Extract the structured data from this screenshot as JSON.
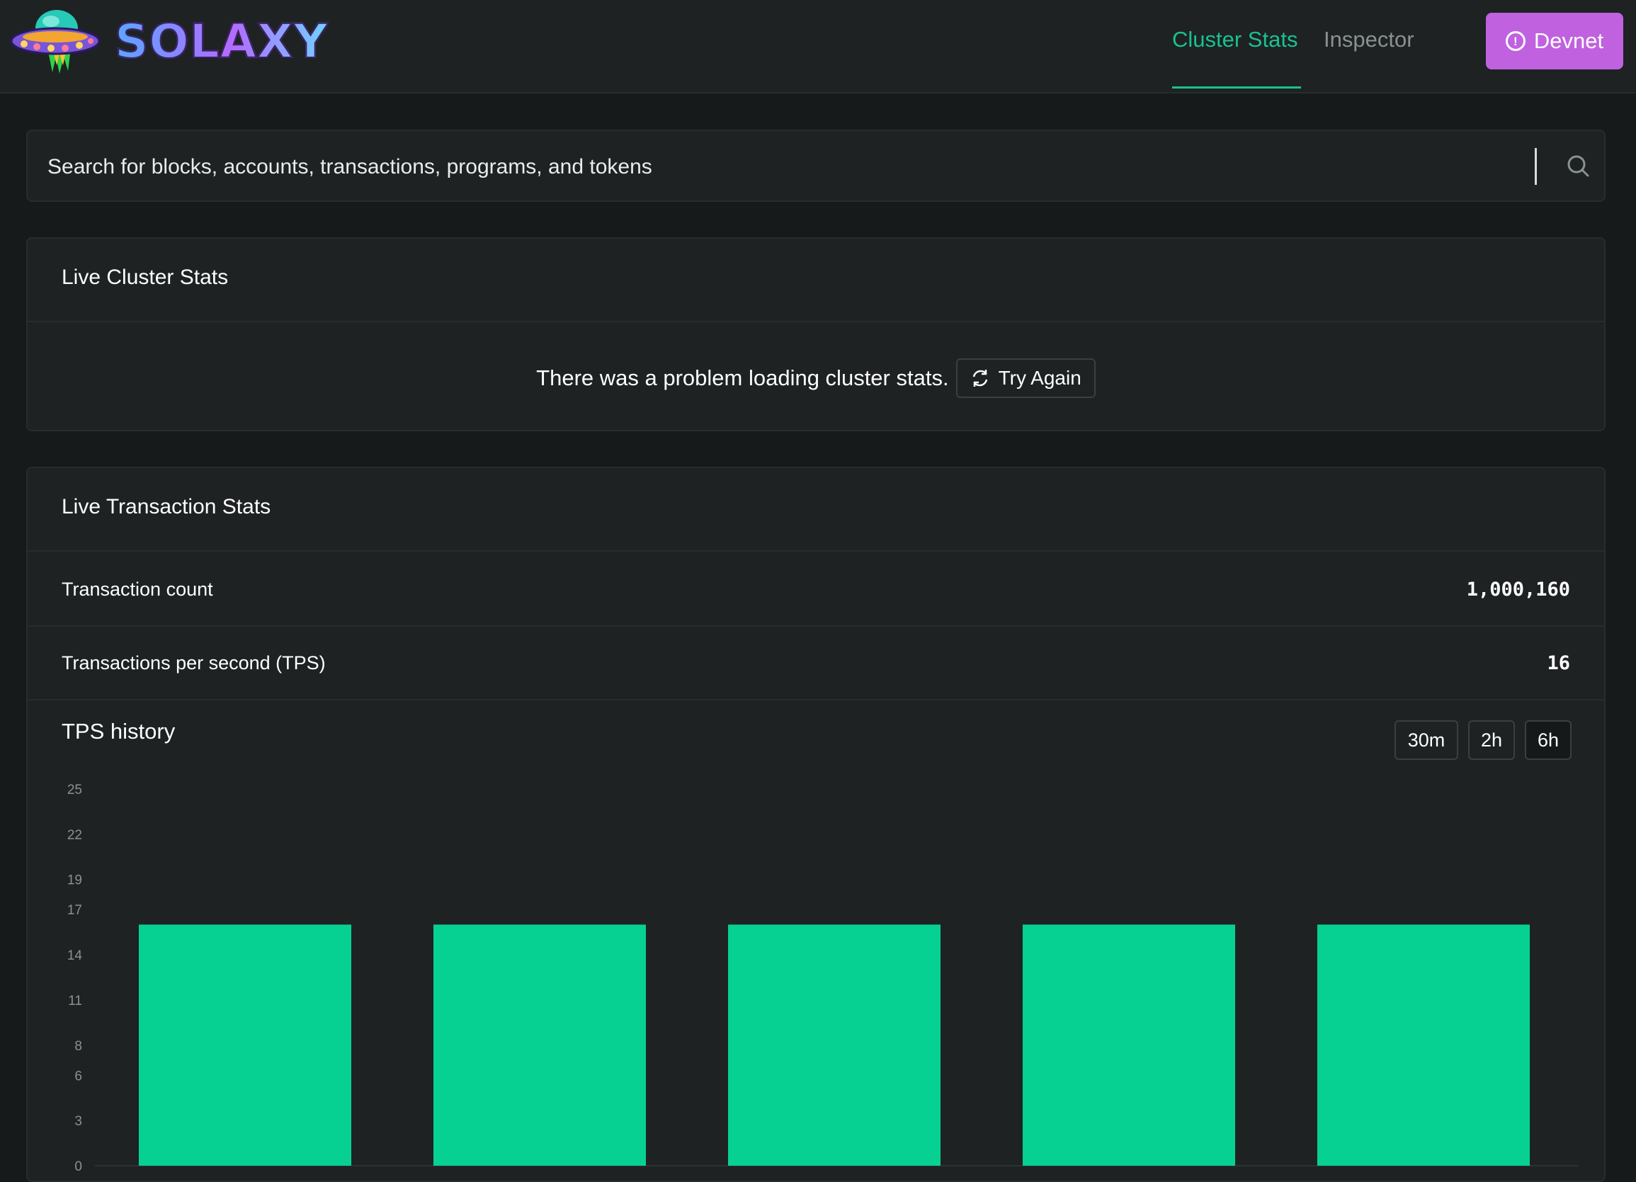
{
  "brand": {
    "name": "SOLAXY"
  },
  "nav": {
    "items": [
      {
        "label": "Cluster Stats",
        "active": true
      },
      {
        "label": "Inspector",
        "active": false
      }
    ],
    "cluster_button": "Devnet",
    "accent_color": "#19c28f",
    "cluster_color": "#c061e0"
  },
  "search": {
    "placeholder": "Search for blocks, accounts, transactions, programs, and tokens",
    "value": ""
  },
  "cluster_stats": {
    "title": "Live Cluster Stats",
    "error_message": "There was a problem loading cluster stats.",
    "retry_label": "Try Again"
  },
  "transaction_stats": {
    "title": "Live Transaction Stats",
    "rows": [
      {
        "label": "Transaction count",
        "value": "1,000,160"
      },
      {
        "label": "Transactions per second (TPS)",
        "value": "16"
      }
    ],
    "history_title": "TPS history",
    "ranges": [
      {
        "label": "30m",
        "active": false
      },
      {
        "label": "2h",
        "active": false
      },
      {
        "label": "6h",
        "active": true
      }
    ]
  },
  "chart_data": {
    "type": "bar",
    "title": "TPS history",
    "xlabel": "",
    "ylabel": "",
    "y_ticks": [
      0,
      3,
      6,
      8,
      11,
      14,
      17,
      19,
      22,
      25
    ],
    "ylim": [
      0,
      25
    ],
    "values": [
      16,
      16,
      16,
      16,
      16
    ],
    "bar_color": "#06d193",
    "grid": false
  }
}
